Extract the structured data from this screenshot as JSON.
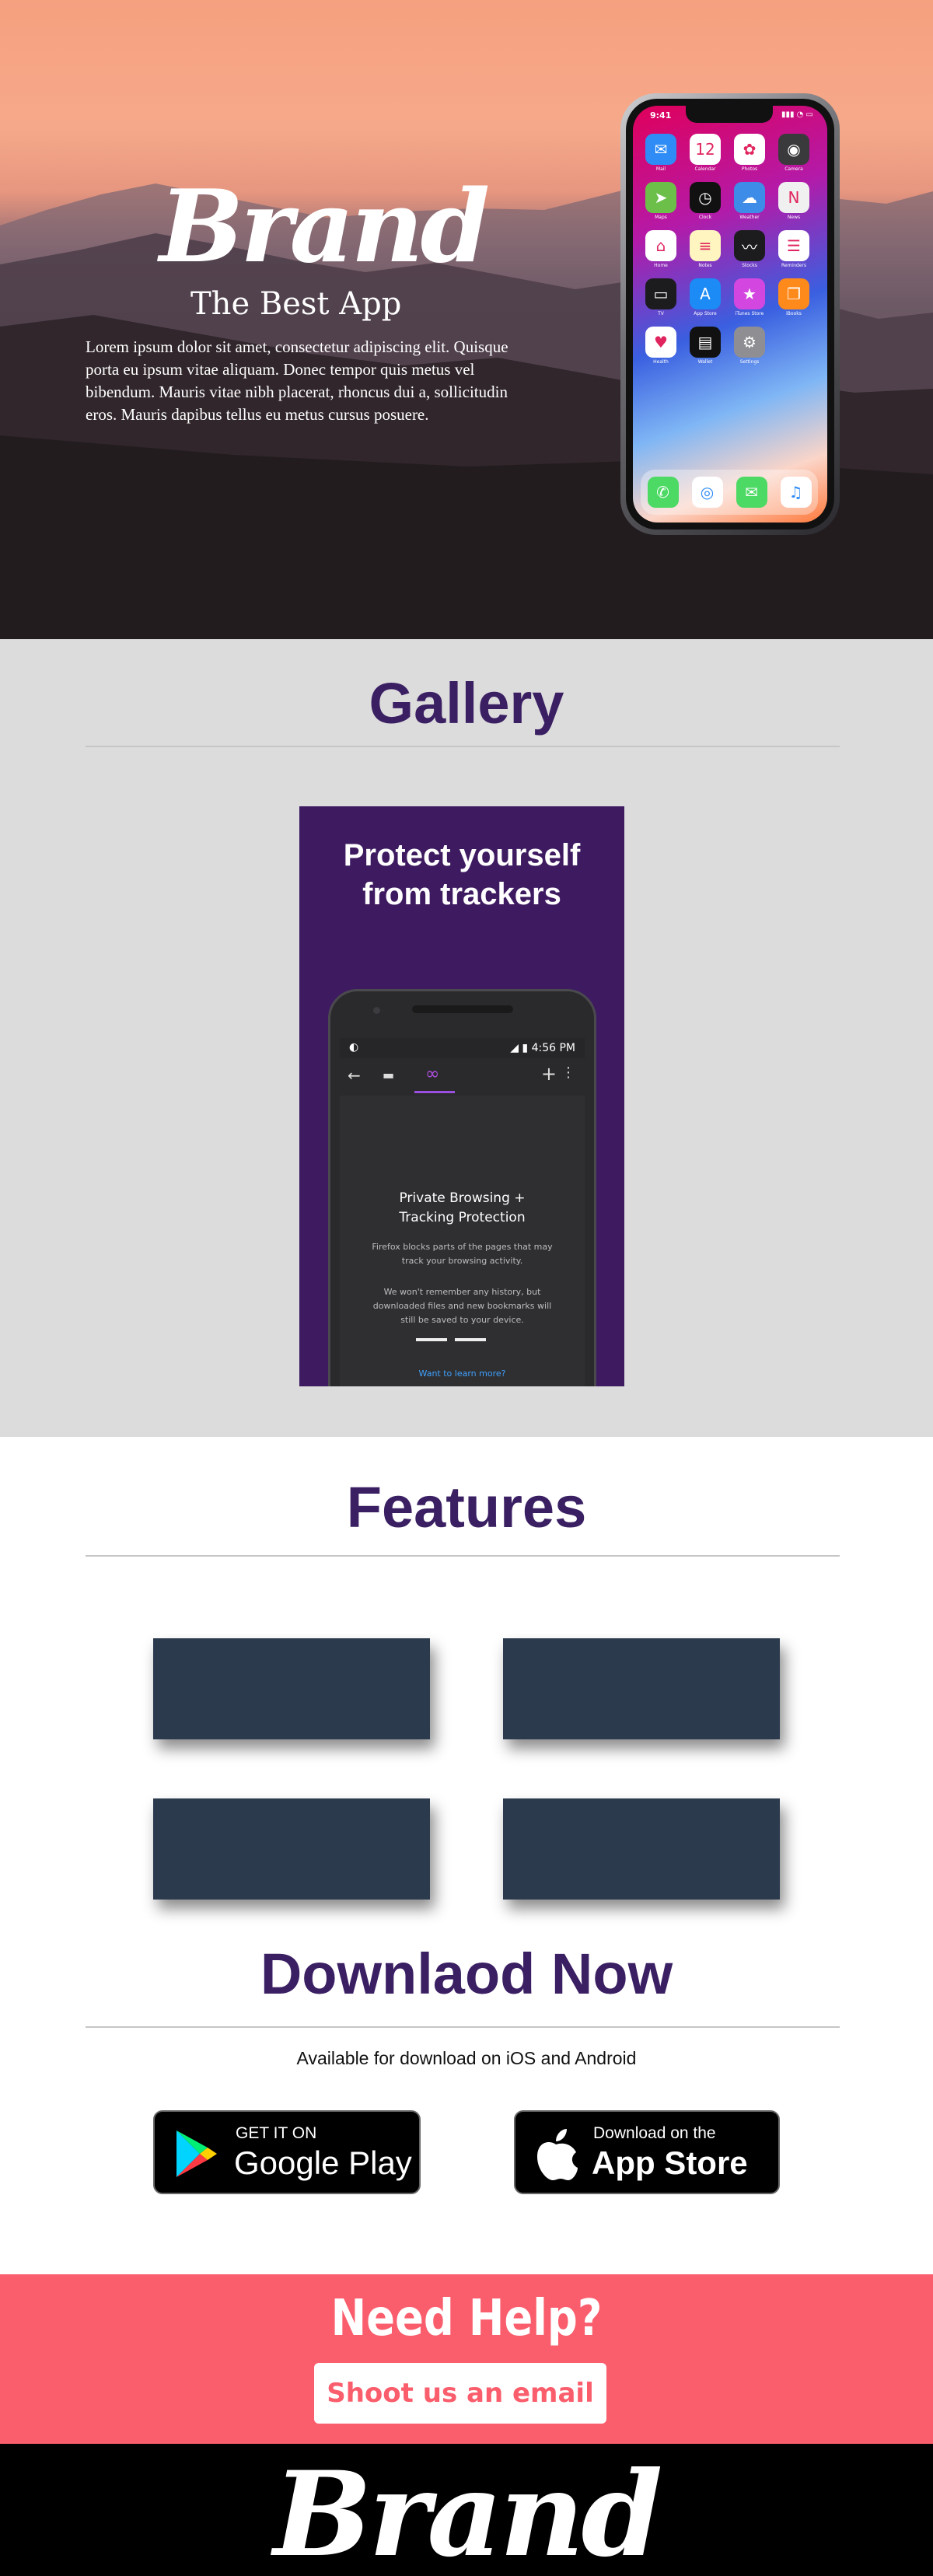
{
  "hero": {
    "brand": "Brand",
    "subtitle": "The Best App",
    "description": "Lorem ipsum dolor sit amet, consectetur adipiscing elit. Quisque porta eu ipsum vitae aliquam. Donec tempor quis metus vel bibendum. Mauris vitae nibh placerat, rhoncus dui a, sollicitudin eros. Mauris dapibus tellus eu metus cursus posuere.",
    "phone": {
      "time": "9:41",
      "apps": [
        {
          "label": "Mail",
          "icon": "mail-icon",
          "color": "#2f8cf6"
        },
        {
          "label": "Calendar",
          "icon": "calendar-icon",
          "color": "#ffffff"
        },
        {
          "label": "Photos",
          "icon": "photos-icon",
          "color": "#ffffff"
        },
        {
          "label": "Camera",
          "icon": "camera-icon",
          "color": "#3a3a3c"
        },
        {
          "label": "Maps",
          "icon": "maps-icon",
          "color": "#6cc04a"
        },
        {
          "label": "Clock",
          "icon": "clock-icon",
          "color": "#111111"
        },
        {
          "label": "Weather",
          "icon": "weather-icon",
          "color": "#3d8ce8"
        },
        {
          "label": "News",
          "icon": "news-icon",
          "color": "#f0f0f0"
        },
        {
          "label": "Home",
          "icon": "home-icon",
          "color": "#ffffff"
        },
        {
          "label": "Notes",
          "icon": "notes-icon",
          "color": "#fff5c0"
        },
        {
          "label": "Stocks",
          "icon": "stocks-icon",
          "color": "#1c1c1e"
        },
        {
          "label": "Reminders",
          "icon": "reminders-icon",
          "color": "#ffffff"
        },
        {
          "label": "TV",
          "icon": "tv-icon",
          "color": "#1c1c1e"
        },
        {
          "label": "App Store",
          "icon": "app-store-icon",
          "color": "#1c8bf5"
        },
        {
          "label": "iTunes Store",
          "icon": "itunes-store-icon",
          "color": "#d347e0"
        },
        {
          "label": "iBooks",
          "icon": "ibooks-icon",
          "color": "#ff8a1c"
        },
        {
          "label": "Health",
          "icon": "health-icon",
          "color": "#ffffff"
        },
        {
          "label": "Wallet",
          "icon": "wallet-icon",
          "color": "#111111"
        },
        {
          "label": "Settings",
          "icon": "settings-icon",
          "color": "#8e8e93"
        }
      ],
      "dock": [
        {
          "icon": "phone-icon",
          "color": "#4cd964"
        },
        {
          "icon": "safari-icon",
          "color": "#ffffff"
        },
        {
          "icon": "messages-icon",
          "color": "#4cd964"
        },
        {
          "icon": "music-icon",
          "color": "#ffffff"
        }
      ]
    }
  },
  "gallery": {
    "title": "Gallery",
    "heading_line1": "Protect yourself",
    "heading_line2": "from trackers",
    "screen": {
      "time": "4:56 PM",
      "title_line1": "Private Browsing +",
      "title_line2": "Tracking Protection",
      "text1_line1": "Firefox blocks parts of the pages that may",
      "text1_line2": "track your browsing activity.",
      "text2_line1": "We won't remember any history, but",
      "text2_line2": "downloaded files and new bookmarks will",
      "text2_line3": "still be saved to your device.",
      "link": "Want to learn more?"
    }
  },
  "features": {
    "title": "Features"
  },
  "download": {
    "title": "Downlaod Now",
    "subtitle": "Available for download on iOS and Android",
    "google_small": "GET IT ON",
    "google_big": "Google Play",
    "apple_small": "Download on the",
    "apple_big": "App Store"
  },
  "help": {
    "title": "Need Help?",
    "button": "Shoot us an email",
    "color": "#fa5d6c"
  },
  "footer": {
    "brand": "Brand"
  },
  "colors": {
    "accent": "#3a1f63",
    "feature_box": "#2c3a4e"
  }
}
